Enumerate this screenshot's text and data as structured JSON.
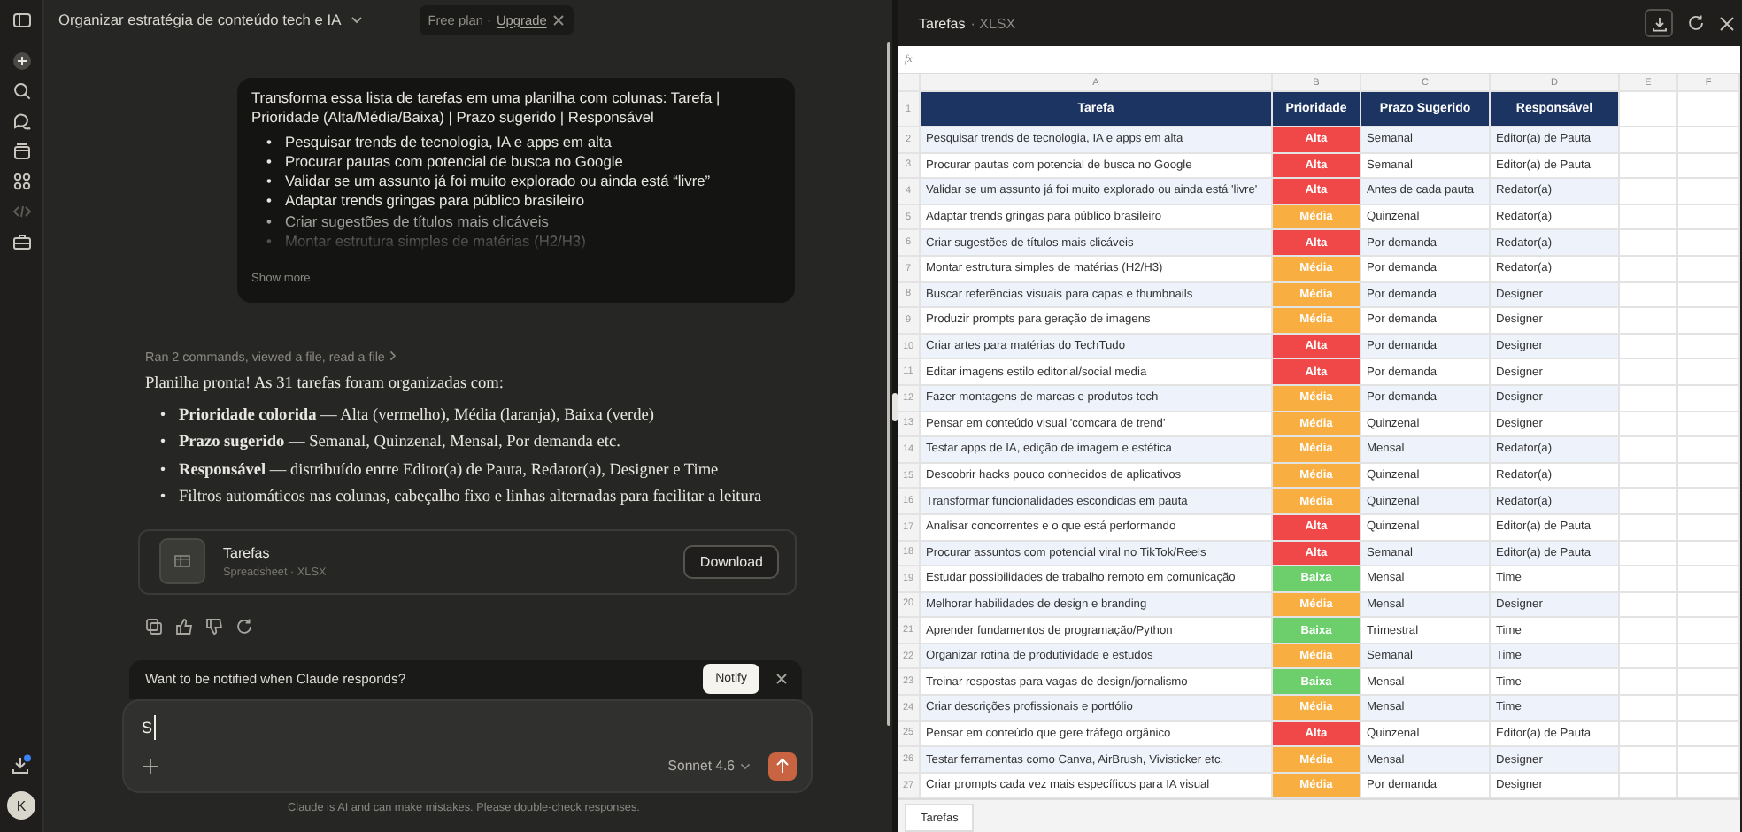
{
  "sidebar": {
    "avatar": "K"
  },
  "chat_header": {
    "title": "Organizar estratégia de conteúdo tech e IA",
    "plan": "Free plan ·",
    "upgrade": "Upgrade"
  },
  "user_message": {
    "text": "Transforma essa lista de tarefas em uma planilha com colunas: Tarefa | Prioridade (Alta/Média/Baixa) | Prazo sugerido | Responsável",
    "items": [
      "Pesquisar trends de tecnologia, IA e apps em alta",
      "Procurar pautas com potencial de busca no Google",
      "Validar se um assunto já foi muito explorado ou ainda está “livre”",
      "Adaptar trends gringas para público brasileiro",
      "Criar sugestões de títulos mais clicáveis",
      "Montar estrutura simples de matérias (H2/H3)"
    ],
    "show_more": "Show more",
    "bullet": "•"
  },
  "tool_summary": "Ran 2 commands, viewed a file, read a file",
  "response": {
    "bullet": "•",
    "intro": "Planilha pronta! As 31 tarefas foram organizadas com:",
    "items": [
      "**Prioridade colorida** — Alta (vermelho), Média (laranja), Baixa (verde)",
      "**Prazo sugerido** — Semanal, Quinzenal, Mensal, Por demanda etc.",
      "**Responsável** — distribuído entre Editor(a) de Pauta, Redator(a), Designer e Time",
      "Filtros automáticos nas colunas, cabeçalho fixo e linhas alternadas para facilitar a leitura"
    ]
  },
  "attachment": {
    "name": "Tarefas",
    "type": "Spreadsheet · XLSX",
    "button": "Download"
  },
  "notify_banner": {
    "text": "Want to be notified when Claude responds?",
    "button": "Notify"
  },
  "composer": {
    "value": "S",
    "model": "Sonnet 4.6"
  },
  "disclaimer": "Claude is AI and can make mistakes. Please double-check responses.",
  "sheet": {
    "title": "Tarefas",
    "format": "· XLSX",
    "formula_label": "fx",
    "columns": [
      "A",
      "B",
      "C",
      "D",
      "E",
      "F"
    ],
    "header": {
      "number": "1",
      "cells": [
        "Tarefa",
        "Prioridade",
        "Prazo Sugerido",
        "Responsável"
      ]
    },
    "rows": [
      {
        "number": "2",
        "task": "Pesquisar trends de tecnologia, IA e apps em alta",
        "priority": "Alta",
        "color": "#f04848",
        "deadline": "Semanal",
        "owner": "Editor(a) de Pauta"
      },
      {
        "number": "3",
        "task": "Procurar pautas com potencial de busca no Google",
        "priority": "Alta",
        "color": "#f04848",
        "deadline": "Semanal",
        "owner": "Editor(a) de Pauta"
      },
      {
        "number": "4",
        "task": "Validar se um assunto já foi muito explorado ou ainda está 'livre'",
        "priority": "Alta",
        "color": "#f04848",
        "deadline": "Antes de cada pauta",
        "owner": "Redator(a)"
      },
      {
        "number": "5",
        "task": "Adaptar trends gringas para público brasileiro",
        "priority": "Média",
        "color": "#f9ae42",
        "deadline": "Quinzenal",
        "owner": "Redator(a)"
      },
      {
        "number": "6",
        "task": "Criar sugestões de títulos mais clicáveis",
        "priority": "Alta",
        "color": "#f04848",
        "deadline": "Por demanda",
        "owner": "Redator(a)"
      },
      {
        "number": "7",
        "task": "Montar estrutura simples de matérias (H2/H3)",
        "priority": "Média",
        "color": "#f9ae42",
        "deadline": "Por demanda",
        "owner": "Redator(a)"
      },
      {
        "number": "8",
        "task": "Buscar referências visuais para capas e thumbnails",
        "priority": "Média",
        "color": "#f9ae42",
        "deadline": "Por demanda",
        "owner": "Designer"
      },
      {
        "number": "9",
        "task": "Produzir prompts para geração de imagens",
        "priority": "Média",
        "color": "#f9ae42",
        "deadline": "Por demanda",
        "owner": "Designer"
      },
      {
        "number": "10",
        "task": "Criar artes para matérias do TechTudo",
        "priority": "Alta",
        "color": "#f04848",
        "deadline": "Por demanda",
        "owner": "Designer"
      },
      {
        "number": "11",
        "task": "Editar imagens estilo editorial/social media",
        "priority": "Alta",
        "color": "#f04848",
        "deadline": "Por demanda",
        "owner": "Designer"
      },
      {
        "number": "12",
        "task": "Fazer montagens de marcas e produtos tech",
        "priority": "Média",
        "color": "#f9ae42",
        "deadline": "Por demanda",
        "owner": "Designer"
      },
      {
        "number": "13",
        "task": "Pensar em conteúdo visual 'comcara de trend'",
        "priority": "Média",
        "color": "#f9ae42",
        "deadline": "Quinzenal",
        "owner": "Designer"
      },
      {
        "number": "14",
        "task": "Testar apps de IA, edição de imagem e estética",
        "priority": "Média",
        "color": "#f9ae42",
        "deadline": "Mensal",
        "owner": "Redator(a)"
      },
      {
        "number": "15",
        "task": "Descobrir hacks pouco conhecidos de aplicativos",
        "priority": "Média",
        "color": "#f9ae42",
        "deadline": "Quinzenal",
        "owner": "Redator(a)"
      },
      {
        "number": "16",
        "task": "Transformar funcionalidades escondidas em pauta",
        "priority": "Média",
        "color": "#f9ae42",
        "deadline": "Quinzenal",
        "owner": "Redator(a)"
      },
      {
        "number": "17",
        "task": "Analisar concorrentes e o que está performando",
        "priority": "Alta",
        "color": "#f04848",
        "deadline": "Quinzenal",
        "owner": "Editor(a) de Pauta"
      },
      {
        "number": "18",
        "task": "Procurar assuntos com potencial viral no TikTok/Reels",
        "priority": "Alta",
        "color": "#f04848",
        "deadline": "Semanal",
        "owner": "Editor(a) de Pauta"
      },
      {
        "number": "19",
        "task": "Estudar possibilidades de trabalho remoto em comunicação",
        "priority": "Baixa",
        "color": "#6ccf6c",
        "deadline": "Mensal",
        "owner": "Time"
      },
      {
        "number": "20",
        "task": "Melhorar habilidades de design e branding",
        "priority": "Média",
        "color": "#f9ae42",
        "deadline": "Mensal",
        "owner": "Designer"
      },
      {
        "number": "21",
        "task": "Aprender fundamentos de programação/Python",
        "priority": "Baixa",
        "color": "#6ccf6c",
        "deadline": "Trimestral",
        "owner": "Time"
      },
      {
        "number": "22",
        "task": "Organizar rotina de produtividade e estudos",
        "priority": "Média",
        "color": "#f9ae42",
        "deadline": "Semanal",
        "owner": "Time"
      },
      {
        "number": "23",
        "task": "Treinar respostas para vagas de design/jornalismo",
        "priority": "Baixa",
        "color": "#6ccf6c",
        "deadline": "Mensal",
        "owner": "Time"
      },
      {
        "number": "24",
        "task": "Criar descrições profissionais e portfólio",
        "priority": "Média",
        "color": "#f9ae42",
        "deadline": "Mensal",
        "owner": "Time"
      },
      {
        "number": "25",
        "task": "Pensar em conteúdo que gere tráfego orgânico",
        "priority": "Alta",
        "color": "#f04848",
        "deadline": "Quinzenal",
        "owner": "Editor(a) de Pauta"
      },
      {
        "number": "26",
        "task": "Testar ferramentas como Canva, AirBrush, Vivisticker etc.",
        "priority": "Média",
        "color": "#f9ae42",
        "deadline": "Mensal",
        "owner": "Designer"
      },
      {
        "number": "27",
        "task": "Criar prompts cada vez mais específicos para IA visual",
        "priority": "Média",
        "color": "#f9ae42",
        "deadline": "Por demanda",
        "owner": "Designer"
      }
    ],
    "tabs": [
      {
        "label": "Tarefas",
        "selected": true
      }
    ]
  }
}
